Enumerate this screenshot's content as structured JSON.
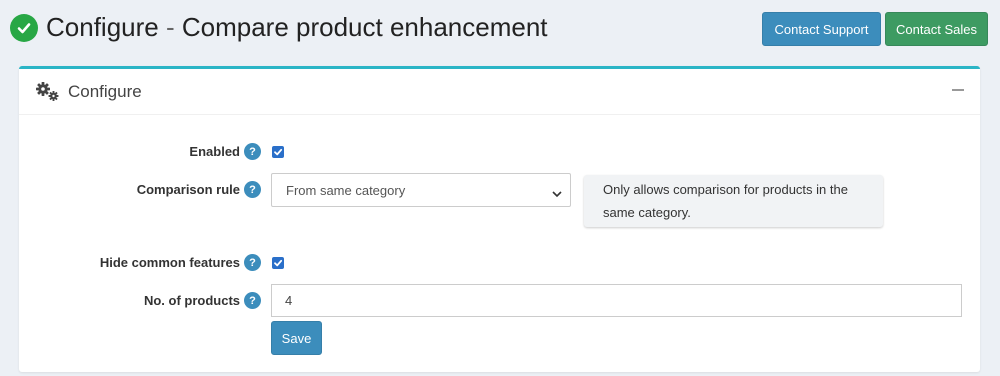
{
  "page": {
    "title_main": "Configure",
    "title_sep": " - ",
    "title_sub": "Compare product enhancement",
    "contact_support": "Contact Support",
    "contact_sales": "Contact Sales"
  },
  "card": {
    "title": "Configure"
  },
  "form": {
    "enabled": {
      "label": "Enabled",
      "checked": true
    },
    "comparison_rule": {
      "label": "Comparison rule",
      "value": "From same category",
      "hint": "Only allows comparison for products in the same category."
    },
    "hide_common": {
      "label": "Hide common features",
      "checked": true
    },
    "num_products": {
      "label": "No. of products",
      "value": "4"
    },
    "save_label": "Save",
    "help_glyph": "?"
  },
  "colors": {
    "accent": "#3c8dbc",
    "sales": "#3d9b62",
    "card_border": "#2bb5c6",
    "success": "#28a745"
  }
}
